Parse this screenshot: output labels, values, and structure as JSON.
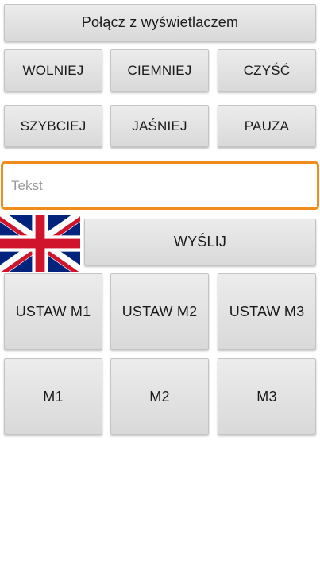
{
  "connect_label": "Połącz z wyświetlaczem",
  "row1": {
    "slower": "WOLNIEJ",
    "darker": "CIEMNIEJ",
    "clear": "CZYŚĆ"
  },
  "row2": {
    "faster": "SZYBCIEJ",
    "brighter": "JAŚNIEJ",
    "pause": "PAUZA"
  },
  "text_input": {
    "placeholder": "Tekst",
    "value": ""
  },
  "language_flag": "uk-flag-icon",
  "send_label": "WYŚLIJ",
  "set_memory": [
    "USTAW M1",
    "USTAW M2",
    "USTAW M3"
  ],
  "memory": [
    "M1",
    "M2",
    "M3"
  ],
  "colors": {
    "input_border": "#f08c1c",
    "button_bg": "#e0e0e0"
  }
}
